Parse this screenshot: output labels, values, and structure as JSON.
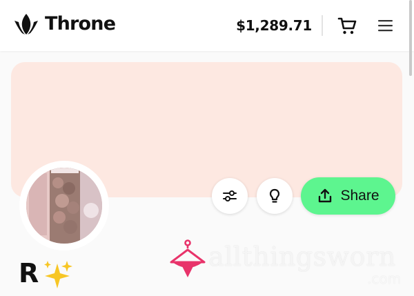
{
  "header": {
    "logo_text": "Throne",
    "balance": "$1,289.71",
    "cart_icon": "cart-icon",
    "menu_icon": "hamburger-menu-icon"
  },
  "profile": {
    "banner_color": "#fde8e1",
    "avatar": "profile-photo",
    "creator_name": "R",
    "name_emoji": "sparkles-emoji"
  },
  "actions": {
    "filter_icon": "sliders-icon",
    "idea_icon": "lightbulb-icon",
    "share_label": "Share",
    "share_icon": "upload-icon",
    "share_color": "#5df58f"
  },
  "watermark": {
    "text": "allthingsworn",
    "sub": ".com",
    "accent": "#e8336a"
  }
}
